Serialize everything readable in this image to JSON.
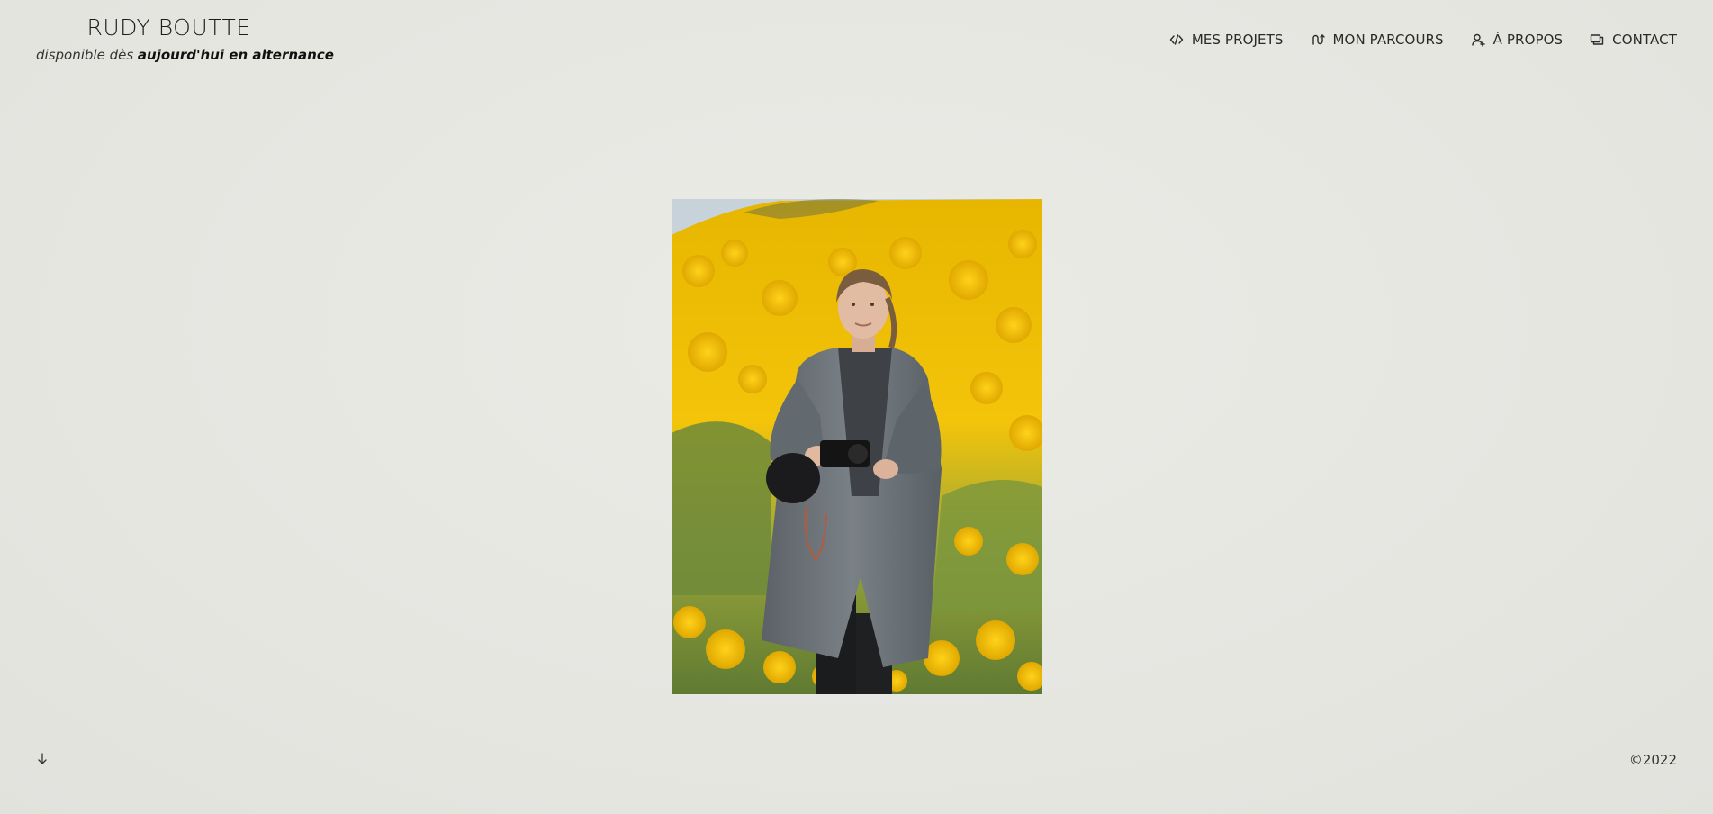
{
  "header": {
    "brand_name": "RUDY BOUTTE",
    "tagline_prefix": "disponible dès ",
    "tagline_emphasis": "aujourd'hui en alternance"
  },
  "nav": {
    "items": [
      {
        "label": "MES PROJETS",
        "icon": "code-icon"
      },
      {
        "label": "MON PARCOURS",
        "icon": "route-icon"
      },
      {
        "label": "À PROPOS",
        "icon": "user-icon"
      },
      {
        "label": "CONTACT",
        "icon": "chat-icon"
      }
    ]
  },
  "footer": {
    "scroll_icon": "arrow-down-icon",
    "copyright": "©2022"
  },
  "colors": {
    "background": "#e8e8e3",
    "text": "#222222",
    "flowers": "#f2c200",
    "coat": "#6d7479"
  }
}
